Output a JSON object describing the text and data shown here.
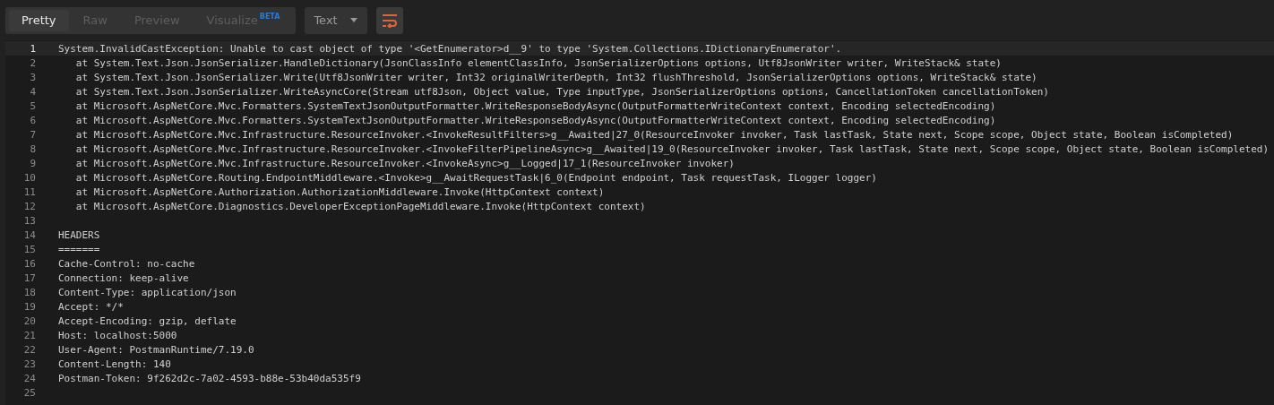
{
  "toolbar": {
    "tabs": [
      {
        "label": "Pretty",
        "selected": true
      },
      {
        "label": "Raw",
        "selected": false
      },
      {
        "label": "Preview",
        "selected": false
      },
      {
        "label": "Visualize",
        "badge": "BETA",
        "selected": false
      }
    ],
    "format_dropdown": {
      "value": "Text"
    },
    "wrap_toggle": {
      "on": true
    }
  },
  "editor": {
    "lines": [
      {
        "number": "1",
        "text": "System.InvalidCastException: Unable to cast object of type '<GetEnumerator>d__9' to type 'System.Collections.IDictionaryEnumerator'.",
        "current": true
      },
      {
        "number": "2",
        "text": "   at System.Text.Json.JsonSerializer.HandleDictionary(JsonClassInfo elementClassInfo, JsonSerializerOptions options, Utf8JsonWriter writer, WriteStack& state)",
        "current": false
      },
      {
        "number": "3",
        "text": "   at System.Text.Json.JsonSerializer.Write(Utf8JsonWriter writer, Int32 originalWriterDepth, Int32 flushThreshold, JsonSerializerOptions options, WriteStack& state)",
        "current": false
      },
      {
        "number": "4",
        "text": "   at System.Text.Json.JsonSerializer.WriteAsyncCore(Stream utf8Json, Object value, Type inputType, JsonSerializerOptions options, CancellationToken cancellationToken)",
        "current": false
      },
      {
        "number": "5",
        "text": "   at Microsoft.AspNetCore.Mvc.Formatters.SystemTextJsonOutputFormatter.WriteResponseBodyAsync(OutputFormatterWriteContext context, Encoding selectedEncoding)",
        "current": false
      },
      {
        "number": "6",
        "text": "   at Microsoft.AspNetCore.Mvc.Formatters.SystemTextJsonOutputFormatter.WriteResponseBodyAsync(OutputFormatterWriteContext context, Encoding selectedEncoding)",
        "current": false
      },
      {
        "number": "7",
        "text": "   at Microsoft.AspNetCore.Mvc.Infrastructure.ResourceInvoker.<InvokeResultFilters>g__Awaited|27_0(ResourceInvoker invoker, Task lastTask, State next, Scope scope, Object state, Boolean isCompleted)",
        "current": false
      },
      {
        "number": "8",
        "text": "   at Microsoft.AspNetCore.Mvc.Infrastructure.ResourceInvoker.<InvokeFilterPipelineAsync>g__Awaited|19_0(ResourceInvoker invoker, Task lastTask, State next, Scope scope, Object state, Boolean isCompleted)",
        "current": false
      },
      {
        "number": "9",
        "text": "   at Microsoft.AspNetCore.Mvc.Infrastructure.ResourceInvoker.<InvokeAsync>g__Logged|17_1(ResourceInvoker invoker)",
        "current": false
      },
      {
        "number": "10",
        "text": "   at Microsoft.AspNetCore.Routing.EndpointMiddleware.<Invoke>g__AwaitRequestTask|6_0(Endpoint endpoint, Task requestTask, ILogger logger)",
        "current": false
      },
      {
        "number": "11",
        "text": "   at Microsoft.AspNetCore.Authorization.AuthorizationMiddleware.Invoke(HttpContext context)",
        "current": false
      },
      {
        "number": "12",
        "text": "   at Microsoft.AspNetCore.Diagnostics.DeveloperExceptionPageMiddleware.Invoke(HttpContext context)",
        "current": false
      },
      {
        "number": "13",
        "current": false
      },
      {
        "number": "14",
        "text": "HEADERS",
        "current": false
      },
      {
        "number": "15",
        "text": "=======",
        "current": false
      },
      {
        "number": "16",
        "text": "Cache-Control: no-cache",
        "current": false
      },
      {
        "number": "17",
        "text": "Connection: keep-alive",
        "current": false
      },
      {
        "number": "18",
        "text": "Content-Type: application/json",
        "current": false
      },
      {
        "number": "19",
        "text": "Accept: */*",
        "current": false
      },
      {
        "number": "20",
        "text": "Accept-Encoding: gzip, deflate",
        "current": false
      },
      {
        "number": "21",
        "text": "Host: localhost:5000",
        "current": false
      },
      {
        "number": "22",
        "text": "User-Agent: PostmanRuntime/7.19.0",
        "current": false
      },
      {
        "number": "23",
        "text": "Content-Length: 140",
        "current": false
      },
      {
        "number": "24",
        "text": "Postman-Token: 9f262d2c-7a02-4593-b88e-53b40da535f9",
        "current": false
      },
      {
        "number": "25",
        "current": false
      }
    ]
  }
}
